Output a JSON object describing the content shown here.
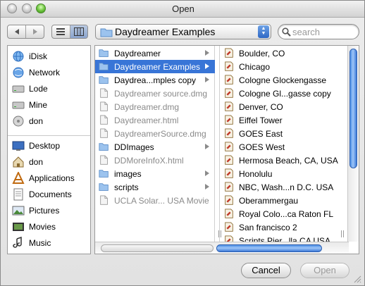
{
  "window": {
    "title": "Open"
  },
  "toolbar": {
    "view_mode": "column",
    "location_popup": {
      "selected": "Daydreamer Examples"
    },
    "search": {
      "placeholder": "search",
      "value": ""
    }
  },
  "sidebar": {
    "devices": [
      {
        "label": "iDisk",
        "icon": "globe-icon"
      },
      {
        "label": "Network",
        "icon": "network-globe-icon"
      },
      {
        "label": "Lode",
        "icon": "hard-drive-icon"
      },
      {
        "label": "Mine",
        "icon": "hard-drive-icon"
      },
      {
        "label": "don",
        "icon": "disk-icon"
      }
    ],
    "places": [
      {
        "label": "Desktop",
        "icon": "desktop-icon"
      },
      {
        "label": "don",
        "icon": "home-icon"
      },
      {
        "label": "Applications",
        "icon": "applications-icon"
      },
      {
        "label": "Documents",
        "icon": "documents-icon"
      },
      {
        "label": "Pictures",
        "icon": "pictures-icon"
      },
      {
        "label": "Movies",
        "icon": "movies-icon"
      },
      {
        "label": "Music",
        "icon": "music-icon"
      }
    ]
  },
  "browser": {
    "column1": [
      {
        "label": "Daydreamer",
        "kind": "folder",
        "selected": false,
        "dim": false
      },
      {
        "label": "Daydreamer Examples",
        "kind": "folder",
        "selected": true,
        "dim": false
      },
      {
        "label": "Daydrea...mples copy",
        "kind": "folder",
        "selected": false,
        "dim": false
      },
      {
        "label": "Daydreamer source.dmg",
        "kind": "file",
        "selected": false,
        "dim": true
      },
      {
        "label": "Daydreamer.dmg",
        "kind": "file",
        "selected": false,
        "dim": true
      },
      {
        "label": "Daydreamer.html",
        "kind": "file",
        "selected": false,
        "dim": true
      },
      {
        "label": "DaydreamerSource.dmg",
        "kind": "file",
        "selected": false,
        "dim": true
      },
      {
        "label": "DDImages",
        "kind": "folder",
        "selected": false,
        "dim": false
      },
      {
        "label": "DDMoreInfoX.html",
        "kind": "file",
        "selected": false,
        "dim": true
      },
      {
        "label": "images",
        "kind": "folder",
        "selected": false,
        "dim": false
      },
      {
        "label": "scripts",
        "kind": "folder",
        "selected": false,
        "dim": false
      },
      {
        "label": "UCLA Solar... USA Movie",
        "kind": "file",
        "selected": false,
        "dim": true
      }
    ],
    "column2": [
      "Boulder, CO",
      "Chicago",
      "Cologne Glockengasse",
      "Cologne Gl...gasse copy",
      "Denver, CO",
      "Eiffel Tower",
      "GOES East",
      "GOES West",
      "Hermosa Beach, CA, USA",
      "Honolulu",
      "NBC, Wash...n D.C. USA",
      "Oberammergau",
      "Royal Colo...ca Raton FL",
      "San francisco 2",
      "Scripts Pier...lla CA USA"
    ]
  },
  "buttons": {
    "cancel": "Cancel",
    "open": "Open"
  },
  "colors": {
    "selection": "#3875d7",
    "scroll_thumb": "#4b8ee6"
  }
}
